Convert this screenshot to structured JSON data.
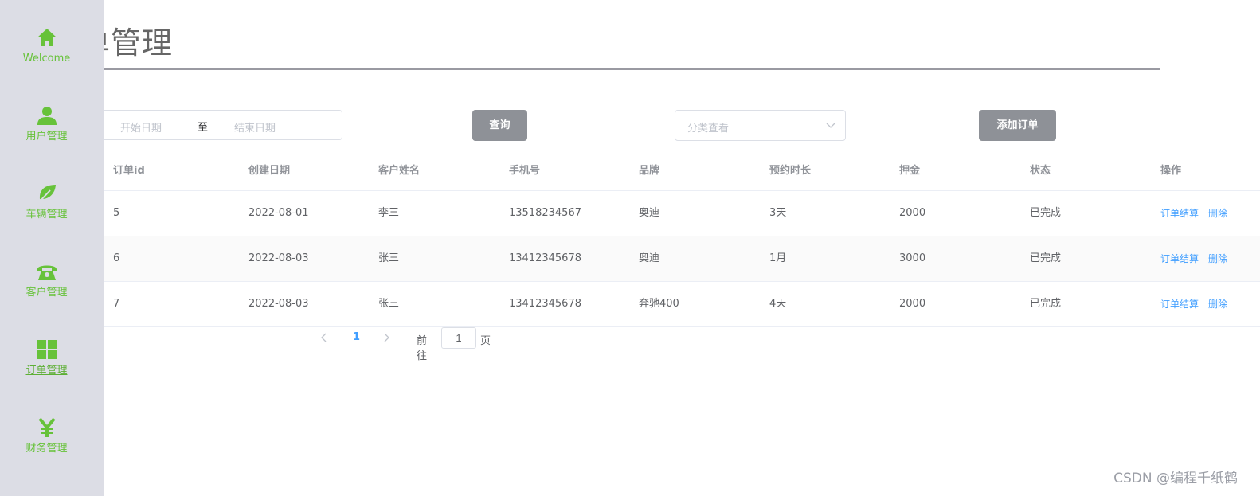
{
  "sidebar": {
    "items": [
      {
        "label": "Welcome",
        "icon": "home-icon"
      },
      {
        "label": "用户管理",
        "icon": "user-icon"
      },
      {
        "label": "车辆管理",
        "icon": "leaf-icon"
      },
      {
        "label": "客户管理",
        "icon": "phone-icon"
      },
      {
        "label": "订单管理",
        "icon": "grid-icon",
        "active": true
      },
      {
        "label": "财务管理",
        "icon": "yen-icon"
      }
    ]
  },
  "header": {
    "title": "单管理"
  },
  "filters": {
    "start_placeholder": "开始日期",
    "separator": "至",
    "end_placeholder": "结束日期",
    "query_label": "查询",
    "category_placeholder": "分类查看",
    "add_label": "添加订单"
  },
  "table": {
    "columns": [
      "订单id",
      "创建日期",
      "客户姓名",
      "手机号",
      "品牌",
      "预约时长",
      "押金",
      "状态",
      "操作"
    ],
    "rows": [
      [
        "5",
        "2022-08-01",
        "李三",
        "13518234567",
        "奥迪",
        "3天",
        "2000",
        "已完成"
      ],
      [
        "6",
        "2022-08-03",
        "张三",
        "13412345678",
        "奥迪",
        "1月",
        "3000",
        "已完成"
      ],
      [
        "7",
        "2022-08-03",
        "张三",
        "13412345678",
        "奔驰400",
        "4天",
        "2000",
        "已完成"
      ]
    ],
    "actions": {
      "settle": "订单结算",
      "delete": "删除"
    }
  },
  "pagination": {
    "current": "1",
    "goto_label": "前往",
    "page_suffix": "页",
    "jump_value": "1"
  },
  "watermark": "CSDN @编程千纸鹤",
  "colors": {
    "accent": "#67c23a",
    "link": "#409eff",
    "button": "#8e9197",
    "sidebar": "#dcdde5"
  }
}
